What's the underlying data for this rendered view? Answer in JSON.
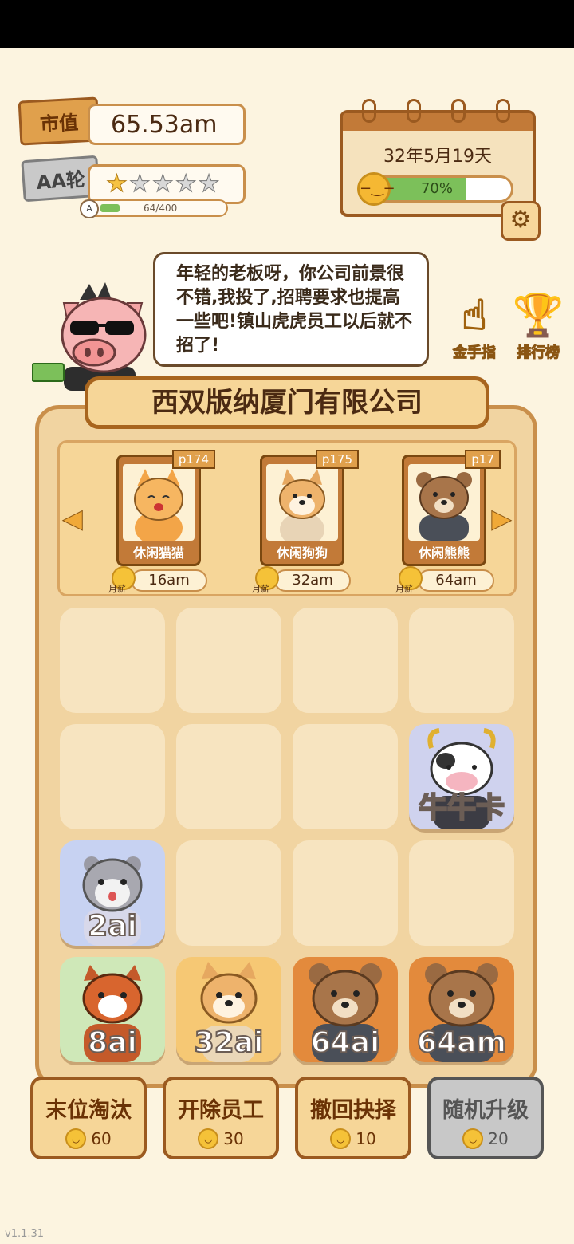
{
  "hud": {
    "market_value_label": "市值",
    "market_value": "65.53am",
    "round_label": "AA轮",
    "stars_filled": 1,
    "stars_total": 5,
    "progress_badge": "A",
    "progress_text": "64/400",
    "progress_value": 64,
    "progress_max": 400
  },
  "calendar": {
    "date": "32年5月19天",
    "mood_percent": "70%",
    "mood_value": 0.7
  },
  "dialogue": {
    "text": "年轻的老板呀，你公司前景很不错,我投了,招聘要求也提高一些吧!镇山虎虎员工以后就不招了!"
  },
  "side_buttons": {
    "golden_finger": "金手指",
    "leaderboard": "排行榜"
  },
  "company": {
    "name": "西双版纳厦门有限公司"
  },
  "recruit": {
    "salary_tag": "月薪",
    "cards": [
      {
        "name": "休闲猫猫",
        "level": "p174",
        "salary": "16am"
      },
      {
        "name": "休闲狗狗",
        "level": "p175",
        "salary": "32am"
      },
      {
        "name": "休闲熊熊",
        "level": "p17",
        "salary": "64am"
      }
    ]
  },
  "grid": {
    "cow_card": "牛牛卡",
    "hamster": "2ai",
    "redpanda": "8ai",
    "shiba": "32ai",
    "bear1": "64ai",
    "bear2": "64am"
  },
  "actions": [
    {
      "label": "末位淘汰",
      "cost": "60"
    },
    {
      "label": "开除员工",
      "cost": "30"
    },
    {
      "label": "撤回抉择",
      "cost": "10"
    },
    {
      "label": "随机升级",
      "cost": "20"
    }
  ],
  "version": "v1.1.31",
  "colors": {
    "background": "#fcf4e0",
    "panel": "#f1d4a1",
    "border_brown": "#9b5a20",
    "progress_green": "#7cc05a",
    "coin_gold": "#f5c238"
  }
}
